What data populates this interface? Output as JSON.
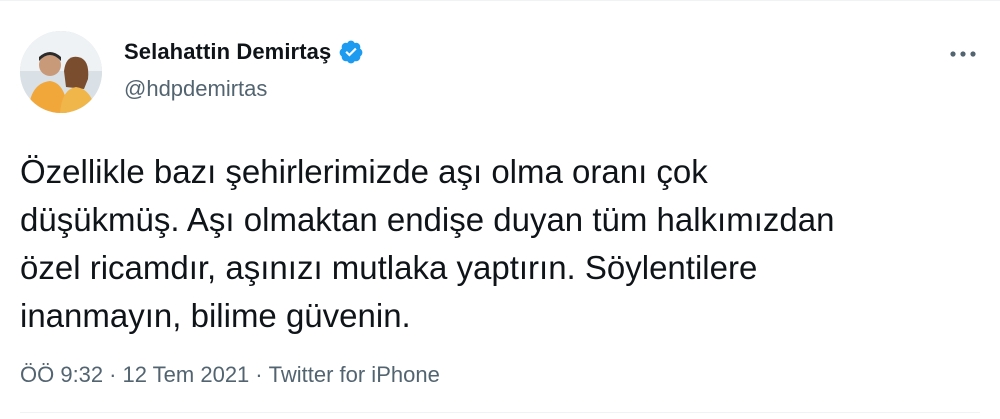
{
  "author": {
    "display_name": "Selahattin Demirtaş",
    "handle": "@hdpdemirtas",
    "verified": true
  },
  "tweet": {
    "text": "Özellikle bazı şehirlerimizde aşı olma oranı çok\ndüşükmüş. Aşı olmaktan endişe duyan tüm halkımızdan\nözel ricamdır, aşınızı mutlaka yaptırın. Söylentilere\ninanmayın, bilime güvenin.",
    "time": "ÖÖ 9:32",
    "separator": "·",
    "date": "12 Tem 2021",
    "source": "Twitter for iPhone"
  },
  "icons": {
    "verified": "verified-badge-icon",
    "more": "more-options-icon"
  },
  "colors": {
    "primary_text": "#0f1419",
    "secondary_text": "#536471",
    "verified_blue": "#1d9bf0",
    "divider": "#eff3f4"
  }
}
